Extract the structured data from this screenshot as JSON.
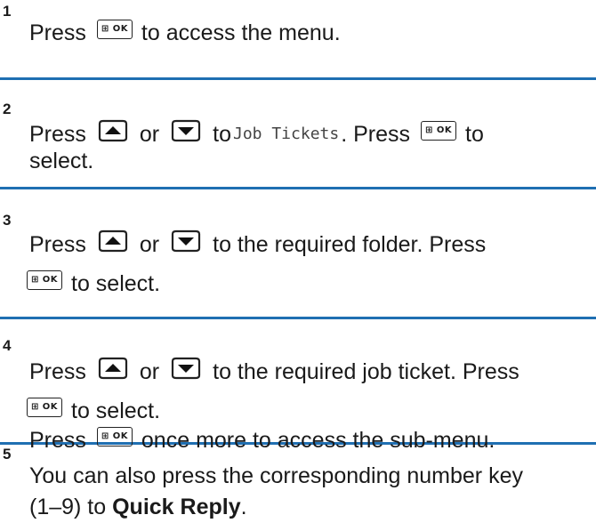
{
  "steps": [
    {
      "number": "1",
      "lines": [
        [
          "Press",
          "[OK]",
          "to access the menu."
        ]
      ]
    },
    {
      "number": "2",
      "text_a": "Press",
      "text_or": "or",
      "text_to": "to",
      "mono": "Job Tickets",
      "text_press": ". Press",
      "text_to2": "to",
      "text_select": "select."
    },
    {
      "number": "3",
      "line1_press": "Press",
      "line1_or": "or",
      "line1_rest": "to the required folder. Press",
      "line2_rest": "to select."
    },
    {
      "number": "4",
      "line1_press": "Press",
      "line1_or": "or",
      "line1_rest": "to the required job ticket. Press",
      "line2_rest": "to select."
    },
    {
      "number": "5",
      "line1_press": "Press",
      "line1_rest": "once more to access the sub-menu.",
      "note_line1": "You can also press the corresponding number key",
      "note_line2_pre": "(1–9) to ",
      "note_line2_bold": "Quick Reply",
      "note_line2_post": "."
    }
  ],
  "step1_press": "Press",
  "step1_rest": "to access the menu.",
  "ok_key_label": "⊞ OK",
  "icons": {
    "up": "up-arrow-key-icon",
    "down": "down-arrow-key-icon",
    "ok": "ok-menu-key-icon"
  },
  "colors": {
    "divider": "#1f6fb2"
  }
}
